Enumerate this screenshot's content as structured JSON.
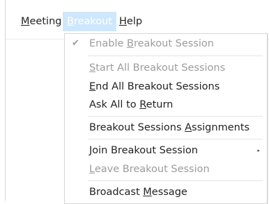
{
  "menubar": {
    "meeting": {
      "pre": "",
      "acc": "M",
      "post": "eeting"
    },
    "breakout": {
      "pre": "",
      "acc": "B",
      "post": "reakout"
    },
    "help": {
      "pre": "",
      "acc": "H",
      "post": "elp"
    }
  },
  "menu": {
    "enable": {
      "pre": "Enable ",
      "acc": "B",
      "post": "reakout Session",
      "check": "✔"
    },
    "start_all": {
      "pre": "",
      "acc": "S",
      "post": "tart All Breakout Sessions"
    },
    "end_all": {
      "pre": "",
      "acc": "E",
      "post": "nd All Breakout Sessions"
    },
    "ask_all": {
      "pre": "Ask All to ",
      "acc": "R",
      "post": "eturn"
    },
    "assignments": {
      "pre": "Breakout Sessions ",
      "acc": "A",
      "post": "ssignments"
    },
    "join": {
      "pre": "",
      "acc": "J",
      "post": "oin Breakout Session",
      "arrow": "▸"
    },
    "leave": {
      "pre": "",
      "acc": "L",
      "post": "eave Breakout Session"
    },
    "broadcast": {
      "pre": "Broadcast ",
      "acc": "M",
      "post": "essage"
    }
  }
}
